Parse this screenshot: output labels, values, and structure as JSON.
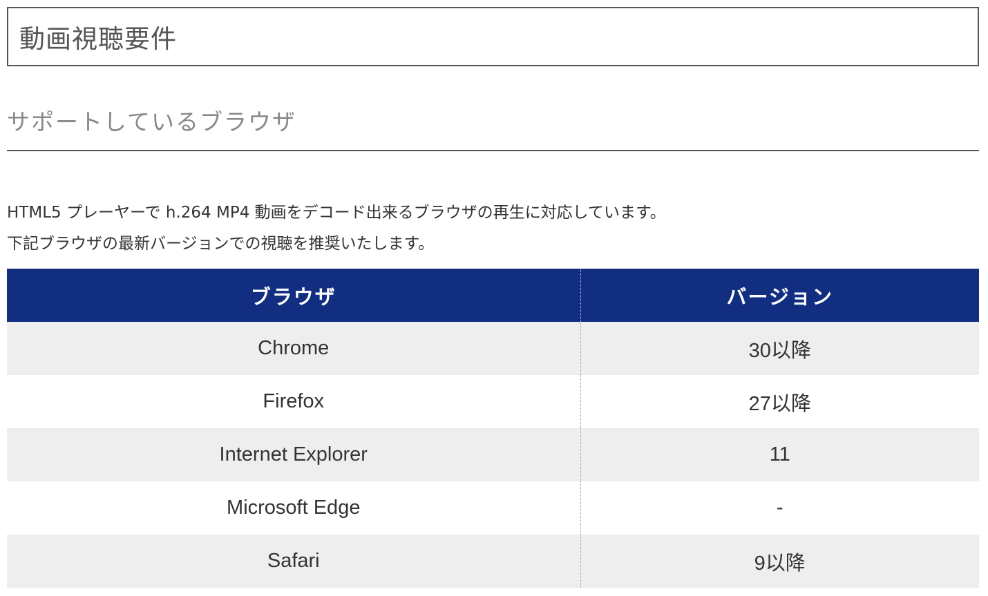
{
  "page_title": "動画視聴要件",
  "section": {
    "heading": "サポートしているブラウザ"
  },
  "description": {
    "line1": "HTML5 プレーヤーで h.264 MP4 動画をデコード出来るブラウザの再生に対応しています。",
    "line2": "下記ブラウザの最新バージョンでの視聴を推奨いたします。"
  },
  "table": {
    "headers": [
      "ブラウザ",
      "バージョン"
    ],
    "rows": [
      {
        "browser": "Chrome",
        "version": "30以降"
      },
      {
        "browser": "Firefox",
        "version": "27以降"
      },
      {
        "browser": "Internet Explorer",
        "version": "11"
      },
      {
        "browser": "Microsoft Edge",
        "version": "-"
      },
      {
        "browser": "Safari",
        "version": "9以降"
      }
    ]
  },
  "colors": {
    "header_bg": "#112e80",
    "header_text": "#ffffff",
    "row_alt_bg": "#eeeeee",
    "row_bg": "#ffffff"
  }
}
